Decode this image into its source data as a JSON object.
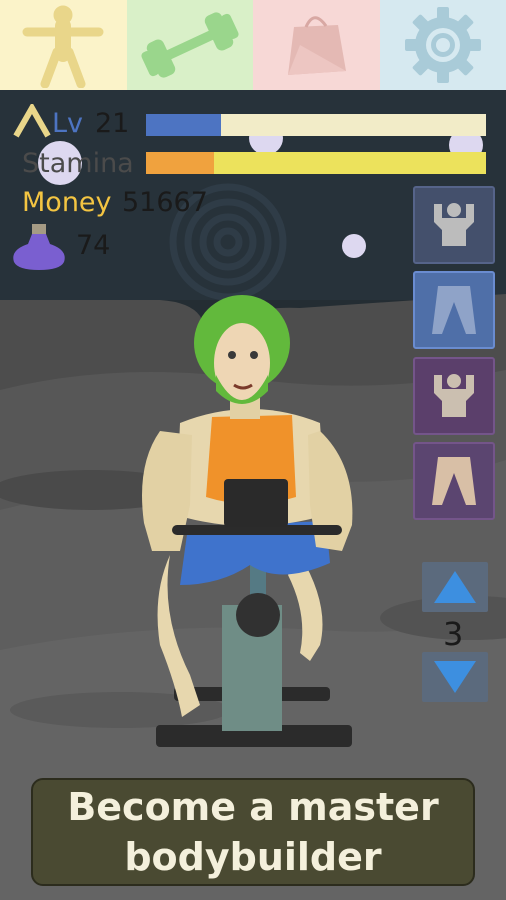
{
  "tabs": [
    {
      "icon": "body-figure-icon",
      "color": "#fbf3c9"
    },
    {
      "icon": "dumbbell-icon",
      "color": "#d9f0c8"
    },
    {
      "icon": "shopping-bag-icon",
      "color": "#f7d8d6"
    },
    {
      "icon": "gear-icon",
      "color": "#d6e9f0"
    }
  ],
  "hud": {
    "level_label": "Lv",
    "level_value": "21",
    "level_progress": 0.22,
    "stamina_label": "Stamina",
    "stamina_progress": 0.2,
    "money_label": "Money",
    "money_value": "51667",
    "potion_value": "74"
  },
  "colors": {
    "level_fill": "#4d74c2",
    "stamina_fill": "#f0a23e",
    "stamina_bar": "#ece25c",
    "money_label": "#f4c542",
    "potion": "#7a5fd0"
  },
  "side_buttons": [
    {
      "icon": "upper-body-icon"
    },
    {
      "icon": "legs-icon"
    },
    {
      "icon": "upper-body-icon"
    },
    {
      "icon": "legs-icon"
    }
  ],
  "stepper": {
    "value": "3"
  },
  "banner": {
    "line1": "Become a master",
    "line2": "bodybuilder"
  }
}
